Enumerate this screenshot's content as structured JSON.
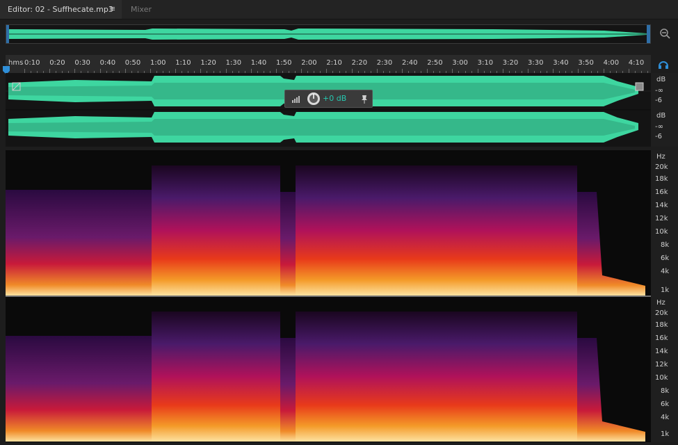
{
  "tabs": {
    "editor_label": "Editor: 02 - Suffhecate.mp3",
    "editor_menu": "≡",
    "mixer_label": "Mixer"
  },
  "ruler": {
    "unit": "hms",
    "labels": [
      "0:10",
      "0:20",
      "0:30",
      "0:40",
      "0:50",
      "1:00",
      "1:10",
      "1:20",
      "1:30",
      "1:40",
      "1:50",
      "2:00",
      "2:10",
      "2:20",
      "2:30",
      "2:40",
      "2:50",
      "3:00",
      "3:10",
      "3:20",
      "3:30",
      "3:40",
      "3:50",
      "4:00",
      "4:10"
    ]
  },
  "waveform": {
    "color": "#3ed6a0",
    "channels": [
      {
        "scale": [
          "dB",
          "-∞",
          "-6"
        ]
      },
      {
        "scale": [
          "dB",
          "-∞",
          "-6"
        ]
      }
    ]
  },
  "hud": {
    "value": "+0 dB"
  },
  "spectral": {
    "channels": [
      {
        "unit": "Hz",
        "labels": [
          "20k",
          "18k",
          "16k",
          "14k",
          "12k",
          "10k",
          "8k",
          "6k",
          "4k",
          "1k"
        ]
      },
      {
        "unit": "Hz",
        "labels": [
          "20k",
          "18k",
          "16k",
          "14k",
          "12k",
          "10k",
          "8k",
          "6k",
          "4k",
          "1k"
        ]
      }
    ]
  },
  "icons": {
    "zoom": "zoom-out-icon",
    "headphones": "headphones-icon",
    "pin": "pin-icon",
    "volume_knob": "volume-knob-icon"
  },
  "colors": {
    "accent": "#26c8b0",
    "playhead": "#2f8fd8"
  }
}
